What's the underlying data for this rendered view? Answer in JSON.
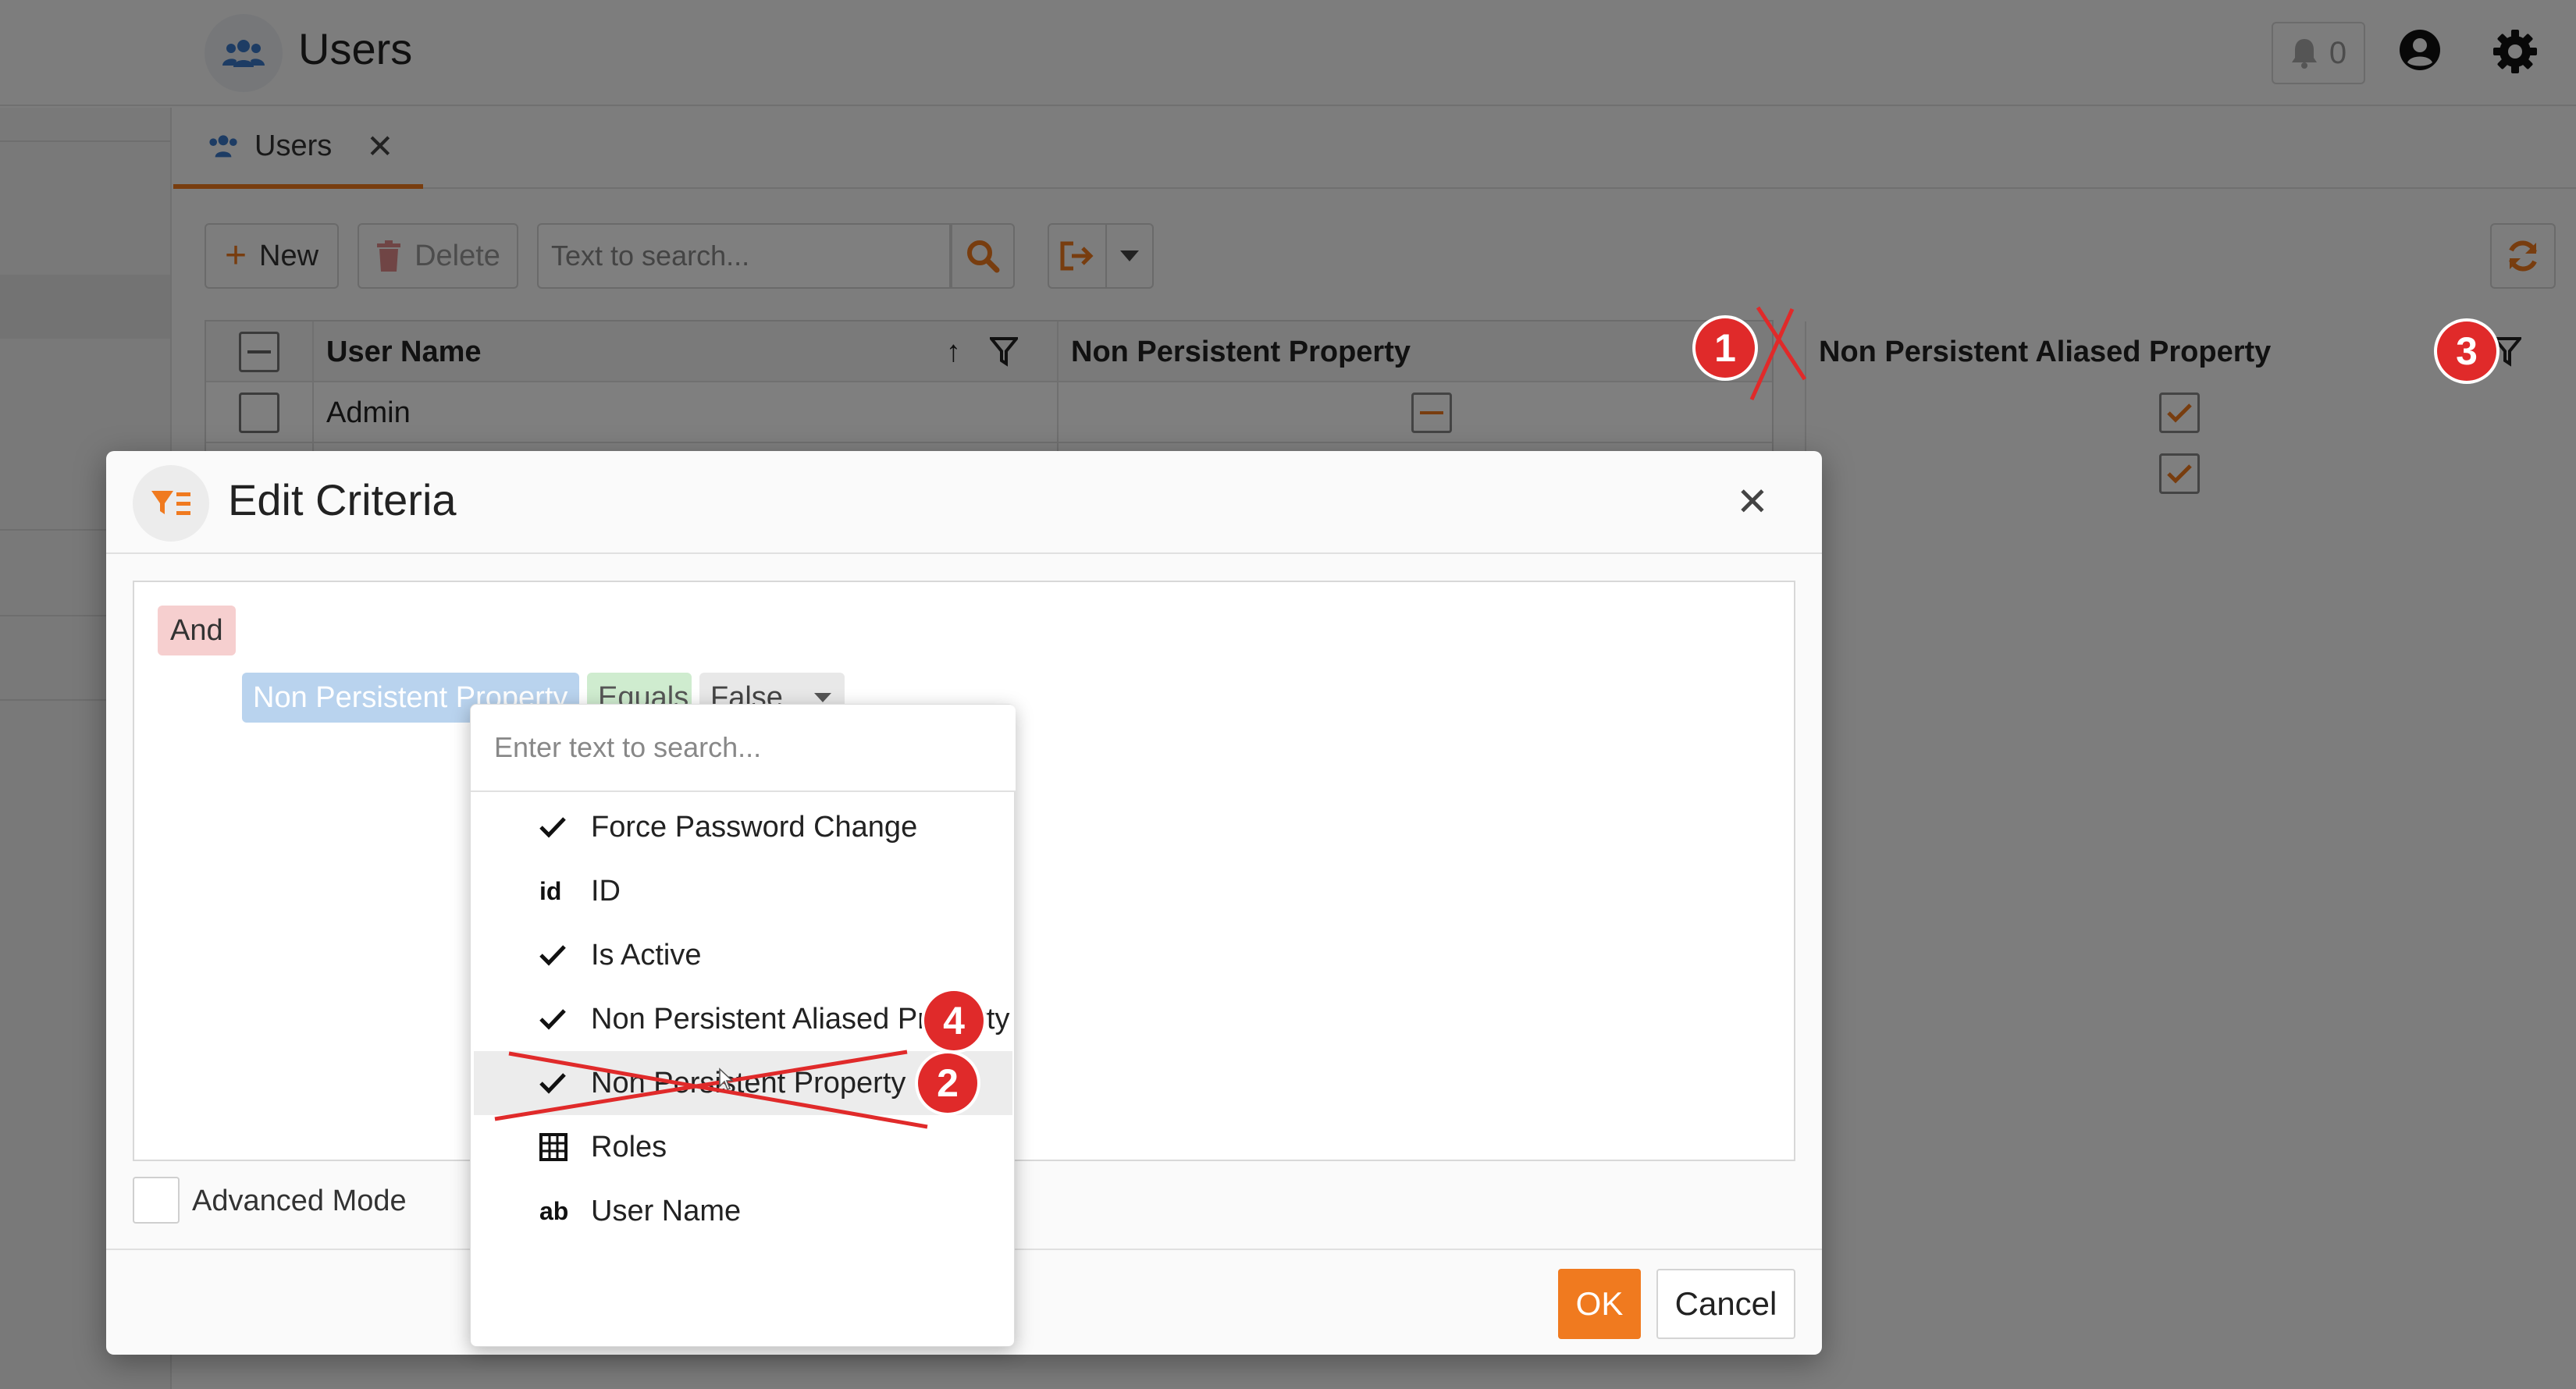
{
  "app": {
    "title": "Users",
    "notifications_count": "0"
  },
  "tabs": [
    {
      "label": "Users"
    }
  ],
  "toolbar": {
    "new_label": "New",
    "delete_label": "Delete",
    "search_placeholder": "Text to search..."
  },
  "grid": {
    "columns": [
      "User Name",
      "Non Persistent Property",
      "Non Persistent Aliased Property"
    ],
    "rows": [
      {
        "user_name": "Admin",
        "non_persistent": "indeterminate",
        "non_persistent_aliased": "checked"
      },
      {
        "user_name": "",
        "non_persistent": "",
        "non_persistent_aliased": "checked"
      }
    ]
  },
  "dialog": {
    "title": "Edit Criteria",
    "group_operator": "And",
    "condition": {
      "property": "Non Persistent Property",
      "operator": "Equals",
      "value": "False"
    },
    "advanced_mode_label": "Advanced Mode",
    "ok_label": "OK",
    "cancel_label": "Cancel"
  },
  "dropdown": {
    "search_placeholder": "Enter text to search...",
    "items": [
      {
        "label": "Force Password Change",
        "icon": "check-icon"
      },
      {
        "label": "ID",
        "icon": "id-icon",
        "glyph": "id"
      },
      {
        "label": "Is Active",
        "icon": "check-icon"
      },
      {
        "label": "Non Persistent Aliased Property",
        "icon": "check-icon"
      },
      {
        "label": "Non Persistent Property",
        "icon": "check-icon",
        "hovered": true
      },
      {
        "label": "Roles",
        "icon": "table-icon"
      },
      {
        "label": "User Name",
        "icon": "text-icon",
        "glyph": "ab"
      }
    ]
  },
  "annotations": [
    "1",
    "2",
    "3",
    "4"
  ],
  "colors": {
    "accent": "#f07a1f",
    "annotation_red": "#e02a2a",
    "overlay": "rgba(0,0,0,0.5)"
  }
}
